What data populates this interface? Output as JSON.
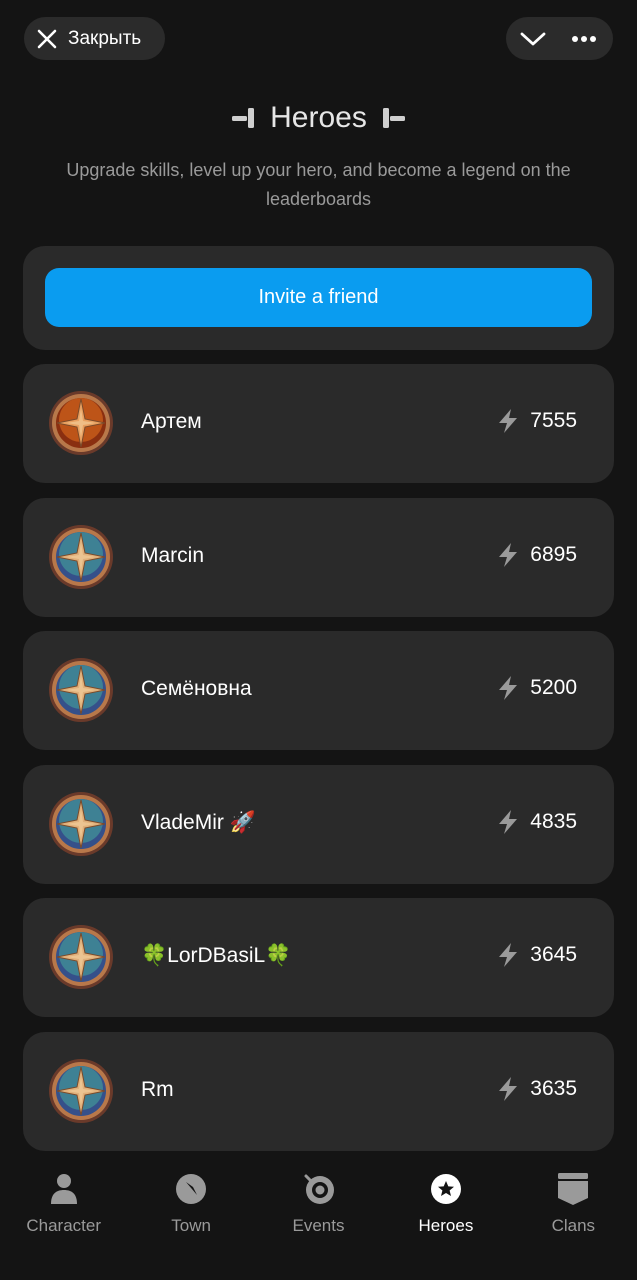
{
  "topbar": {
    "close_label": "Закрыть"
  },
  "header": {
    "title": "Heroes",
    "subtitle": "Upgrade skills, level up your hero, and become a legend on the leaderboards"
  },
  "invite": {
    "label": "Invite a friend"
  },
  "heroes": [
    {
      "name": "Артем",
      "score": "7555",
      "avatar": "orange-shield"
    },
    {
      "name": "Marcin",
      "score": "6895",
      "avatar": "teal-compass-shield"
    },
    {
      "name": "Семёновна",
      "score": "5200",
      "avatar": "teal-compass-shield"
    },
    {
      "name": "VladeMir 🚀",
      "score": "4835",
      "avatar": "teal-compass-shield"
    },
    {
      "name": "🍀LorDBasiL🍀",
      "score": "3645",
      "avatar": "teal-compass-shield"
    },
    {
      "name": "Rm",
      "score": "3635",
      "avatar": "teal-compass-shield"
    }
  ],
  "tabs": [
    {
      "label": "Character",
      "icon": "person-icon",
      "active": false
    },
    {
      "label": "Town",
      "icon": "compass-icon",
      "active": false
    },
    {
      "label": "Events",
      "icon": "target-icon",
      "active": false
    },
    {
      "label": "Heroes",
      "icon": "star-icon",
      "active": true
    },
    {
      "label": "Clans",
      "icon": "banner-icon",
      "active": false
    }
  ],
  "colors": {
    "accent": "#0a9cf0",
    "card": "#2a2a2a",
    "background": "#141414"
  }
}
